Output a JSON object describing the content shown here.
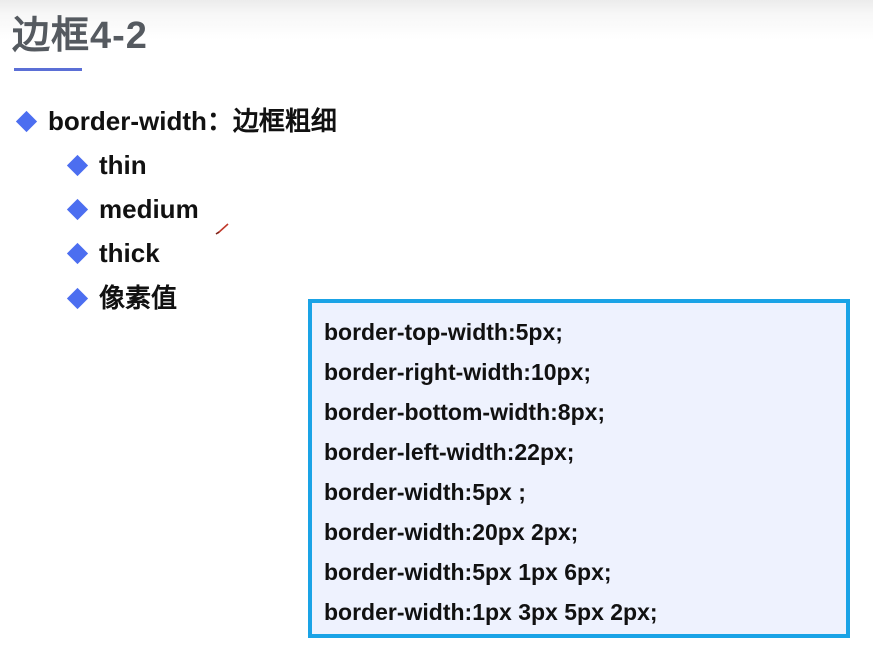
{
  "title": "边框4-2",
  "bullets": {
    "main": "border-width：边框粗细",
    "items": [
      "thin",
      "medium",
      "thick",
      "像素值"
    ]
  },
  "code_lines": [
    "border-top-width:5px;",
    "border-right-width:10px;",
    "border-bottom-width:8px;",
    "border-left-width:22px;",
    "border-width:5px ;",
    "border-width:20px 2px;",
    "border-width:5px 1px 6px;",
    "border-width:1px 3px 5px 2px;"
  ],
  "colors": {
    "title": "#555a60",
    "accent_underline": "#5b6fd6",
    "bullet_diamond": "#4c6ef0",
    "code_border": "#1aa3e6",
    "code_background": "#eef2fe"
  },
  "icons": {
    "bullet": "diamond-bullet-icon",
    "cursor": "pen-cursor-icon"
  }
}
